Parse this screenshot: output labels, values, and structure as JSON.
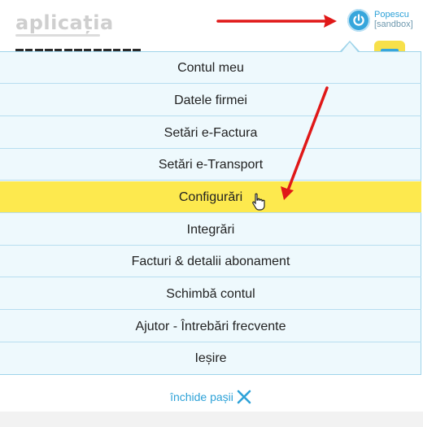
{
  "header": {
    "logo_text": "aplicația",
    "user": {
      "name": "Popescu",
      "mode": "[sandbox]",
      "icon": "power-icon"
    }
  },
  "menu": {
    "items": [
      {
        "label": "Contul meu"
      },
      {
        "label": "Datele firmei"
      },
      {
        "label": "Setări e-Factura"
      },
      {
        "label": "Setări e-Transport"
      },
      {
        "label": "Configurări",
        "active": true
      },
      {
        "label": "Integrări"
      },
      {
        "label": "Facturi & detalii abonament"
      },
      {
        "label": "Schimbă contul"
      },
      {
        "label": "Ajutor - Întrebări frecvente"
      },
      {
        "label": "Ieșire"
      }
    ]
  },
  "footer": {
    "close_steps_label": "închide pașii",
    "close_icon": "close-x-icon"
  },
  "colors": {
    "accent_blue": "#36a6dc",
    "highlight_yellow": "#fde94e",
    "annotation_red": "#e01818"
  }
}
